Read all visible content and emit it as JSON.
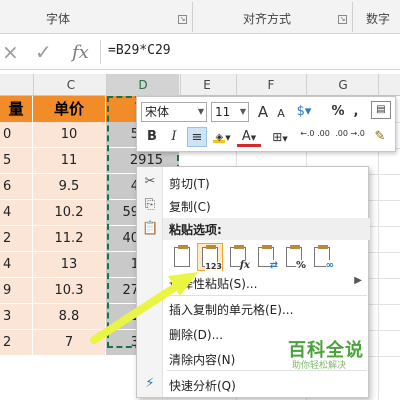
{
  "ribbon": {
    "groups": [
      "字体",
      "对齐方式",
      "数字"
    ]
  },
  "formula_bar": {
    "cancel_icon": "×",
    "enter_icon": "✓",
    "fx_label": "fx",
    "formula": "=B29*C29"
  },
  "columns": {
    "c": "C",
    "d": "D",
    "e": "E",
    "f": "F",
    "g": "G"
  },
  "table": {
    "headers": {
      "b": "量",
      "c": "单价",
      "d": "营"
    },
    "rows": [
      {
        "b": "0",
        "c": "10",
        "d": "5"
      },
      {
        "b": "5",
        "c": "11",
        "d": "2915"
      },
      {
        "b": "6",
        "c": "9.5",
        "d": "4"
      },
      {
        "b": "4",
        "c": "10.2",
        "d": "59"
      },
      {
        "b": "2",
        "c": "11.2",
        "d": "40"
      },
      {
        "b": "4",
        "c": "13",
        "d": "1"
      },
      {
        "b": "9",
        "c": "10.3",
        "d": "27"
      },
      {
        "b": "3",
        "c": "8.8",
        "d": "1"
      },
      {
        "b": "2",
        "c": "7",
        "d": "3"
      }
    ]
  },
  "mini_toolbar": {
    "font_name": "宋体",
    "font_size": "11",
    "grow_font": "A",
    "shrink_font": "A",
    "percent": "%",
    "comma": ",",
    "bold": "B",
    "italic": "I",
    "font_color_letter": "A",
    "inc_decimal": "←.0 .00",
    "dec_decimal": ".00 →.0"
  },
  "context_menu": {
    "cut": "剪切(T)",
    "copy": "复制(C)",
    "paste_options": "粘贴选项:",
    "paste_option_badge": "123",
    "paste_special": "选择性粘贴(S)...",
    "insert_copied": "插入复制的单元格(E)...",
    "delete": "删除(D)...",
    "clear_contents": "清除内容(N)",
    "quick_analysis": "快速分析(Q)"
  },
  "watermark": {
    "title": "百科全说",
    "subtitle": "助你轻松解决"
  },
  "colors": {
    "header_orange": "#f28c28",
    "cell_peach": "#fbe5d6",
    "selection_gray": "#c9c9c9",
    "marquee_green": "#1e7145",
    "arrow_yellow": "#e9f542",
    "watermark_green": "#4aa23a"
  }
}
